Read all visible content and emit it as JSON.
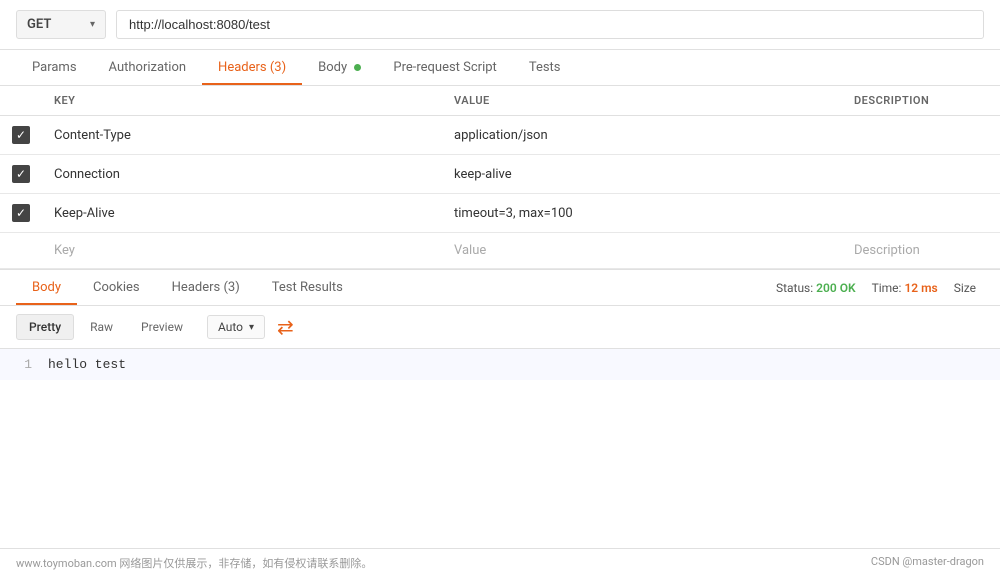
{
  "url_bar": {
    "method": "GET",
    "chevron": "▾",
    "url": "http://localhost:8080/test"
  },
  "request_tabs": [
    {
      "id": "params",
      "label": "Params",
      "active": false,
      "dot": false
    },
    {
      "id": "authorization",
      "label": "Authorization",
      "active": false,
      "dot": false
    },
    {
      "id": "headers",
      "label": "Headers (3)",
      "active": true,
      "dot": false
    },
    {
      "id": "body",
      "label": "Body",
      "active": false,
      "dot": true
    },
    {
      "id": "pre-request",
      "label": "Pre-request Script",
      "active": false,
      "dot": false
    },
    {
      "id": "tests",
      "label": "Tests",
      "active": false,
      "dot": false
    }
  ],
  "headers_table": {
    "columns": [
      "",
      "KEY",
      "VALUE",
      "DESCRIPTION"
    ],
    "rows": [
      {
        "checked": true,
        "key": "Content-Type",
        "value": "application/json",
        "description": ""
      },
      {
        "checked": true,
        "key": "Connection",
        "value": "keep-alive",
        "description": ""
      },
      {
        "checked": true,
        "key": "Keep-Alive",
        "value": "timeout=3, max=100",
        "description": ""
      },
      {
        "checked": false,
        "key": "Key",
        "value": "Value",
        "description": "Description",
        "placeholder": true
      }
    ]
  },
  "response_tabs": [
    {
      "id": "body",
      "label": "Body",
      "active": true
    },
    {
      "id": "cookies",
      "label": "Cookies",
      "active": false
    },
    {
      "id": "headers",
      "label": "Headers (3)",
      "active": false
    },
    {
      "id": "test-results",
      "label": "Test Results",
      "active": false
    }
  ],
  "response_status": {
    "status_label": "Status:",
    "status_value": "200 OK",
    "time_label": "Time:",
    "time_value": "12 ms",
    "size_label": "Size"
  },
  "format_tabs": [
    {
      "id": "pretty",
      "label": "Pretty",
      "active": true
    },
    {
      "id": "raw",
      "label": "Raw",
      "active": false
    },
    {
      "id": "preview",
      "label": "Preview",
      "active": false
    }
  ],
  "auto_dropdown": {
    "label": "Auto",
    "chevron": "▾"
  },
  "wrap_icon": "⇌",
  "response_body": {
    "lines": [
      {
        "number": "1",
        "content": "hello test"
      }
    ]
  },
  "footer": {
    "left": "www.toymoban.com 网络图片仅供展示，非存储，如有侵权请联系删除。",
    "right": "CSDN @master-dragon"
  }
}
